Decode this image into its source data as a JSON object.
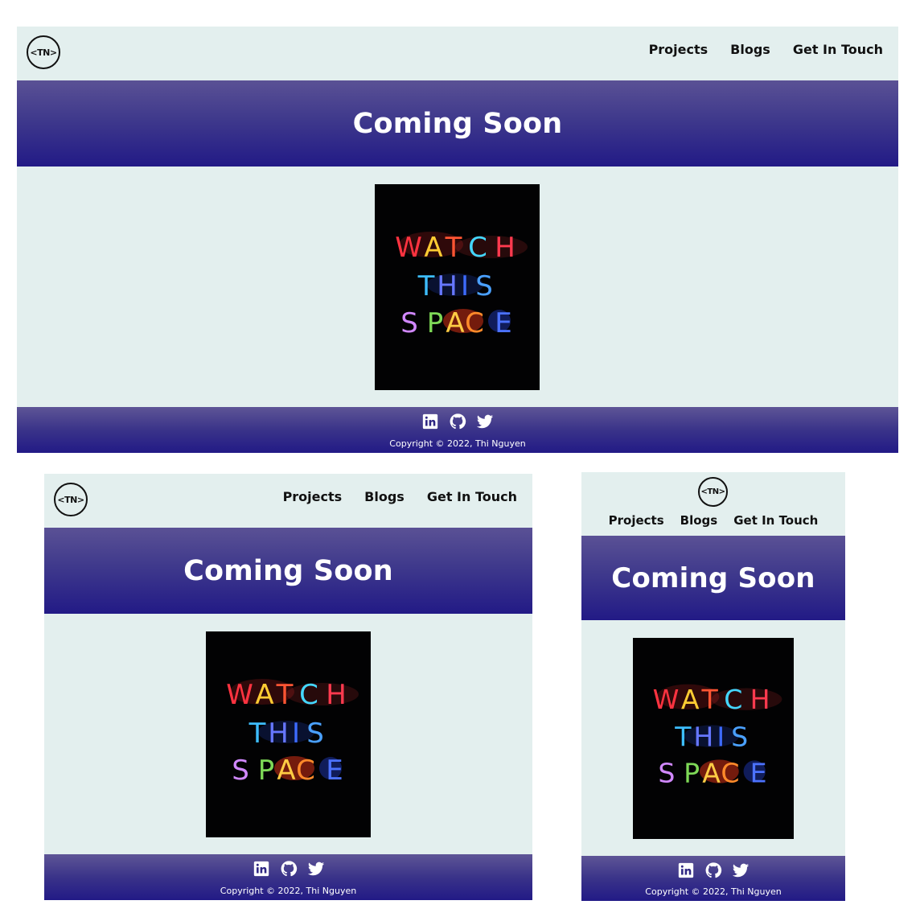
{
  "logo_text": "<TN>",
  "nav": {
    "projects": "Projects",
    "blogs": "Blogs",
    "contact": "Get In Touch"
  },
  "hero_title": "Coming Soon",
  "poster": {
    "line1": "WATCH",
    "line2": "THIS",
    "line3": "SPACE"
  },
  "footer": {
    "copyright": "Copyright © 2022, Thi Nguyen"
  },
  "icons": [
    "linkedin-icon",
    "github-icon",
    "twitter-icon"
  ],
  "colors": {
    "page_bg": "#e3efee",
    "hero_top": "#5a5195",
    "hero_bottom": "#221a86"
  }
}
